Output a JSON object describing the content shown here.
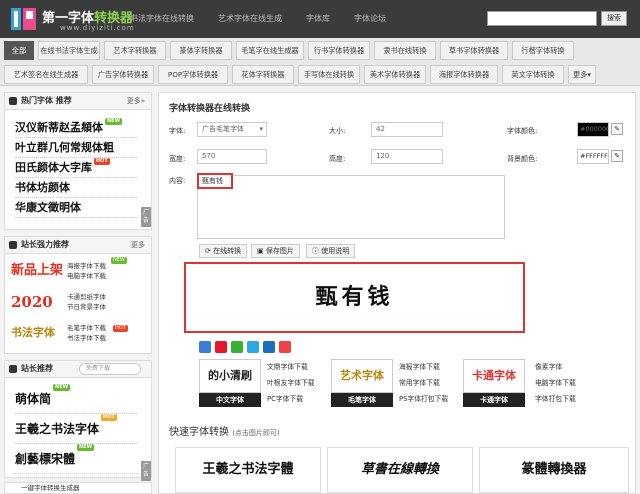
{
  "header": {
    "logo_title_a": "第一字体",
    "logo_title_b": "转换器",
    "logo_url": "www.diyiziti.com",
    "nav": [
      "书法字体在线转换",
      "艺术字体在线生成",
      "字体库",
      "字体论坛"
    ],
    "search_button": "搜索"
  },
  "categories": {
    "row1": [
      "全部",
      "在线书法字体生成",
      "艺术字转换器",
      "篆体字转换器",
      "毛笔字在线生成器",
      "行书字体转换器",
      "隶书在线转换",
      "草书字体转换器",
      "行楷字体转换"
    ],
    "row2": [
      "艺术签名在线生成器",
      "广告字体转换器",
      "POP字体转换器",
      "花体字转换器",
      "手写体在线转换",
      "美术字体转换器",
      "海报字体转换器",
      "英文字体转换",
      "更多▾"
    ]
  },
  "sidebar": {
    "hot_title": "热门字体 推荐",
    "more": "更多»",
    "hot_fonts": [
      "汉仪新蒂赵孟頫体",
      "叶立群几何常规体粗",
      "田氏颜体大字库",
      "书体坊颜体",
      "华康文徵明体"
    ],
    "hot_badges": [
      "NEW",
      "",
      "HOT",
      "",
      ""
    ],
    "ad": "广告",
    "rec_title": "站长强力推荐",
    "rec_more": "更多",
    "rec_items": [
      {
        "img": "新品上架",
        "line1": "海报字体下载",
        "line2": "电脑字体下载",
        "badge": "NEW"
      },
      {
        "img": "2020",
        "line1": "卡通剪纸字体",
        "line2": "节日背景字体",
        "badge": ""
      },
      {
        "img": "书法字体",
        "line1": "毛笔字体下载",
        "line2": "书法字体下载",
        "badge": "HOT"
      }
    ],
    "pick_title": "站长推荐",
    "pick_search": "免费下载",
    "pick_fonts": [
      "萌体简",
      "王羲之书法字体",
      "創藝標宋體"
    ],
    "pick_badges": [
      "NEW",
      "HOT",
      "NEW"
    ],
    "bottom": "一键字体转换生成器"
  },
  "main": {
    "title": "字体转换器在线转换",
    "font_label": "字体:",
    "font_value": "广告毛笔字体",
    "size_label": "大小:",
    "size_value": "42",
    "fontcolor_label": "字体颜色:",
    "fontcolor_value": "#000000",
    "width_label": "宽度:",
    "width_value": "570",
    "height_label": "高度:",
    "height_value": "120",
    "bgcolor_label": "背景颜色:",
    "bgcolor_value": "#FFFFFF",
    "content_label": "内容:",
    "content_value": "甄有钱",
    "btn_convert": "在线转换",
    "btn_save": "保存图片",
    "btn_help": "使用说明",
    "preview_text": "甄有钱"
  },
  "downloads": {
    "cards": [
      {
        "art": "的小清刷",
        "caption": "中文字体"
      },
      {
        "art": "艺术字体",
        "caption": "毛笔字体"
      },
      {
        "art": "卡通字体",
        "caption": "卡通字体"
      }
    ],
    "links_a": [
      "文鼎字体下载",
      "叶根友字体下载",
      "PC字体下载"
    ],
    "links_b": [
      "海报字体下载",
      "常用字体下载",
      "PS字体打包下载"
    ],
    "links_c": [
      "像素字体",
      "电脑字体下载",
      "字体打包下载"
    ]
  },
  "quick": {
    "title": "快速字体转换",
    "hint": "(点击图片即可)",
    "samples": [
      "王羲之书法字體",
      "草書在線轉換",
      "篆體轉換器"
    ]
  }
}
